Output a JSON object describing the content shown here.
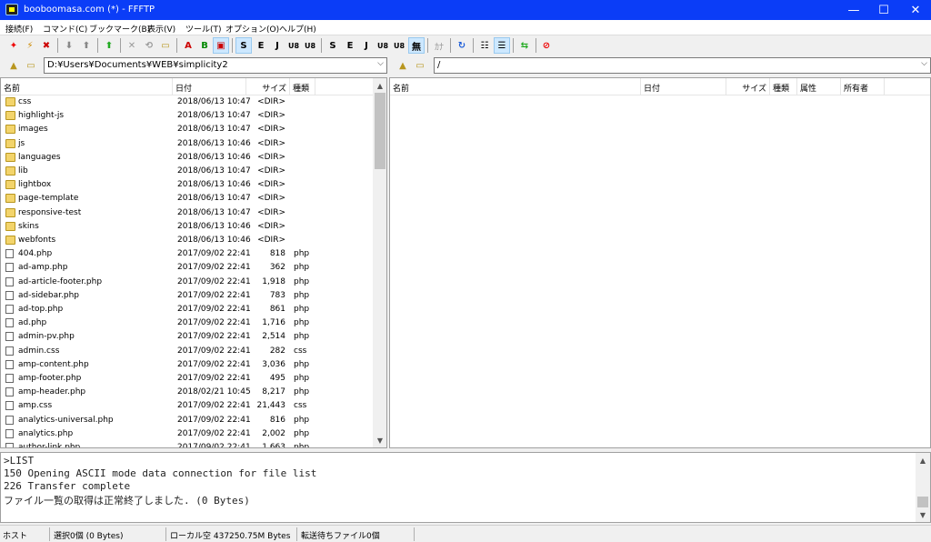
{
  "window": {
    "title": "booboomasa.com (*) - FFFTP",
    "minimize_glyph": "—",
    "maximize_glyph": "☐",
    "close_glyph": "✕"
  },
  "menu": [
    "接続(F)",
    "コマンド(C)",
    "ブックマーク(B)",
    "表示(V)",
    "ツール(T)",
    "オプション(O)",
    "ヘルプ(H)"
  ],
  "toolbar": {
    "icons": [
      "connect-icon",
      "quick-connect-icon",
      "disconnect-icon",
      "download-icon",
      "upload-icon",
      "mirror-upload-icon",
      "delete-icon",
      "rename-icon",
      "mkdir-icon",
      "ascii-mode-icon",
      "binary-mode-icon",
      "auto-mode-icon",
      "sjis-icon",
      "euc-icon",
      "jis-icon",
      "utf8-icon",
      "utf8bom-icon",
      "sjis-remote-icon",
      "euc-remote-icon",
      "jis-remote-icon",
      "utf8-remote-icon",
      "utf8bom-remote-icon",
      "no-convert-icon",
      "kana-icon",
      "refresh-icon",
      "list-view-icon",
      "detail-view-icon",
      "sync-icon",
      "stop-icon"
    ],
    "labels": {
      "sjis": "S",
      "euc": "E",
      "jis": "J",
      "utf8": "U8",
      "utf8bom": "U8",
      "no_convert": "無",
      "kana": "ｶﾅ"
    }
  },
  "local": {
    "path": "D:¥Users¥Documents¥WEB¥simplicity2",
    "columns": {
      "name": "名前",
      "date": "日付",
      "size": "サイズ",
      "type": "種類"
    },
    "files": [
      {
        "name": "css",
        "date": "2018/06/13 10:47",
        "size": "<DIR>",
        "type": "",
        "kind": "folder"
      },
      {
        "name": "highlight-js",
        "date": "2018/06/13 10:47",
        "size": "<DIR>",
        "type": "",
        "kind": "folder"
      },
      {
        "name": "images",
        "date": "2018/06/13 10:47",
        "size": "<DIR>",
        "type": "",
        "kind": "folder"
      },
      {
        "name": "js",
        "date": "2018/06/13 10:46",
        "size": "<DIR>",
        "type": "",
        "kind": "folder"
      },
      {
        "name": "languages",
        "date": "2018/06/13 10:46",
        "size": "<DIR>",
        "type": "",
        "kind": "folder"
      },
      {
        "name": "lib",
        "date": "2018/06/13 10:47",
        "size": "<DIR>",
        "type": "",
        "kind": "folder"
      },
      {
        "name": "lightbox",
        "date": "2018/06/13 10:46",
        "size": "<DIR>",
        "type": "",
        "kind": "folder"
      },
      {
        "name": "page-template",
        "date": "2018/06/13 10:47",
        "size": "<DIR>",
        "type": "",
        "kind": "folder"
      },
      {
        "name": "responsive-test",
        "date": "2018/06/13 10:47",
        "size": "<DIR>",
        "type": "",
        "kind": "folder"
      },
      {
        "name": "skins",
        "date": "2018/06/13 10:46",
        "size": "<DIR>",
        "type": "",
        "kind": "folder"
      },
      {
        "name": "webfonts",
        "date": "2018/06/13 10:46",
        "size": "<DIR>",
        "type": "",
        "kind": "folder"
      },
      {
        "name": "404.php",
        "date": "2017/09/02 22:41",
        "size": "818",
        "type": "php",
        "kind": "file"
      },
      {
        "name": "ad-amp.php",
        "date": "2017/09/02 22:41",
        "size": "362",
        "type": "php",
        "kind": "file"
      },
      {
        "name": "ad-article-footer.php",
        "date": "2017/09/02 22:41",
        "size": "1,918",
        "type": "php",
        "kind": "file"
      },
      {
        "name": "ad-sidebar.php",
        "date": "2017/09/02 22:41",
        "size": "783",
        "type": "php",
        "kind": "file"
      },
      {
        "name": "ad-top.php",
        "date": "2017/09/02 22:41",
        "size": "861",
        "type": "php",
        "kind": "file"
      },
      {
        "name": "ad.php",
        "date": "2017/09/02 22:41",
        "size": "1,716",
        "type": "php",
        "kind": "file"
      },
      {
        "name": "admin-pv.php",
        "date": "2017/09/02 22:41",
        "size": "2,514",
        "type": "php",
        "kind": "file"
      },
      {
        "name": "admin.css",
        "date": "2017/09/02 22:41",
        "size": "282",
        "type": "css",
        "kind": "file"
      },
      {
        "name": "amp-content.php",
        "date": "2017/09/02 22:41",
        "size": "3,036",
        "type": "php",
        "kind": "file"
      },
      {
        "name": "amp-footer.php",
        "date": "2017/09/02 22:41",
        "size": "495",
        "type": "php",
        "kind": "file"
      },
      {
        "name": "amp-header.php",
        "date": "2018/02/21 10:45",
        "size": "8,217",
        "type": "php",
        "kind": "file"
      },
      {
        "name": "amp.css",
        "date": "2017/09/02 22:41",
        "size": "21,443",
        "type": "css",
        "kind": "file"
      },
      {
        "name": "analytics-universal.php",
        "date": "2017/09/02 22:41",
        "size": "816",
        "type": "php",
        "kind": "file"
      },
      {
        "name": "analytics.php",
        "date": "2017/09/02 22:41",
        "size": "2,002",
        "type": "php",
        "kind": "file"
      },
      {
        "name": "author-link.php",
        "date": "2017/09/02 22:41",
        "size": "1,663",
        "type": "php",
        "kind": "file"
      }
    ]
  },
  "remote": {
    "path": "/",
    "columns": {
      "name": "名前",
      "date": "日付",
      "size": "サイズ",
      "type": "種類",
      "attr": "属性",
      "owner": "所有者"
    }
  },
  "log": [
    ">LIST",
    "150 Opening ASCII mode data connection for file list",
    "226 Transfer complete",
    "ファイル一覧の取得は正常終了しました. (0 Bytes)"
  ],
  "status": {
    "host": "ホスト",
    "selection": "選択0個 (0 Bytes)",
    "local_free": "ローカル空 437250.75M Bytes",
    "queue": "転送待ちファイル0個"
  },
  "colors": {
    "titlebar": "#0b3df7",
    "accent": "#cde8ff"
  }
}
